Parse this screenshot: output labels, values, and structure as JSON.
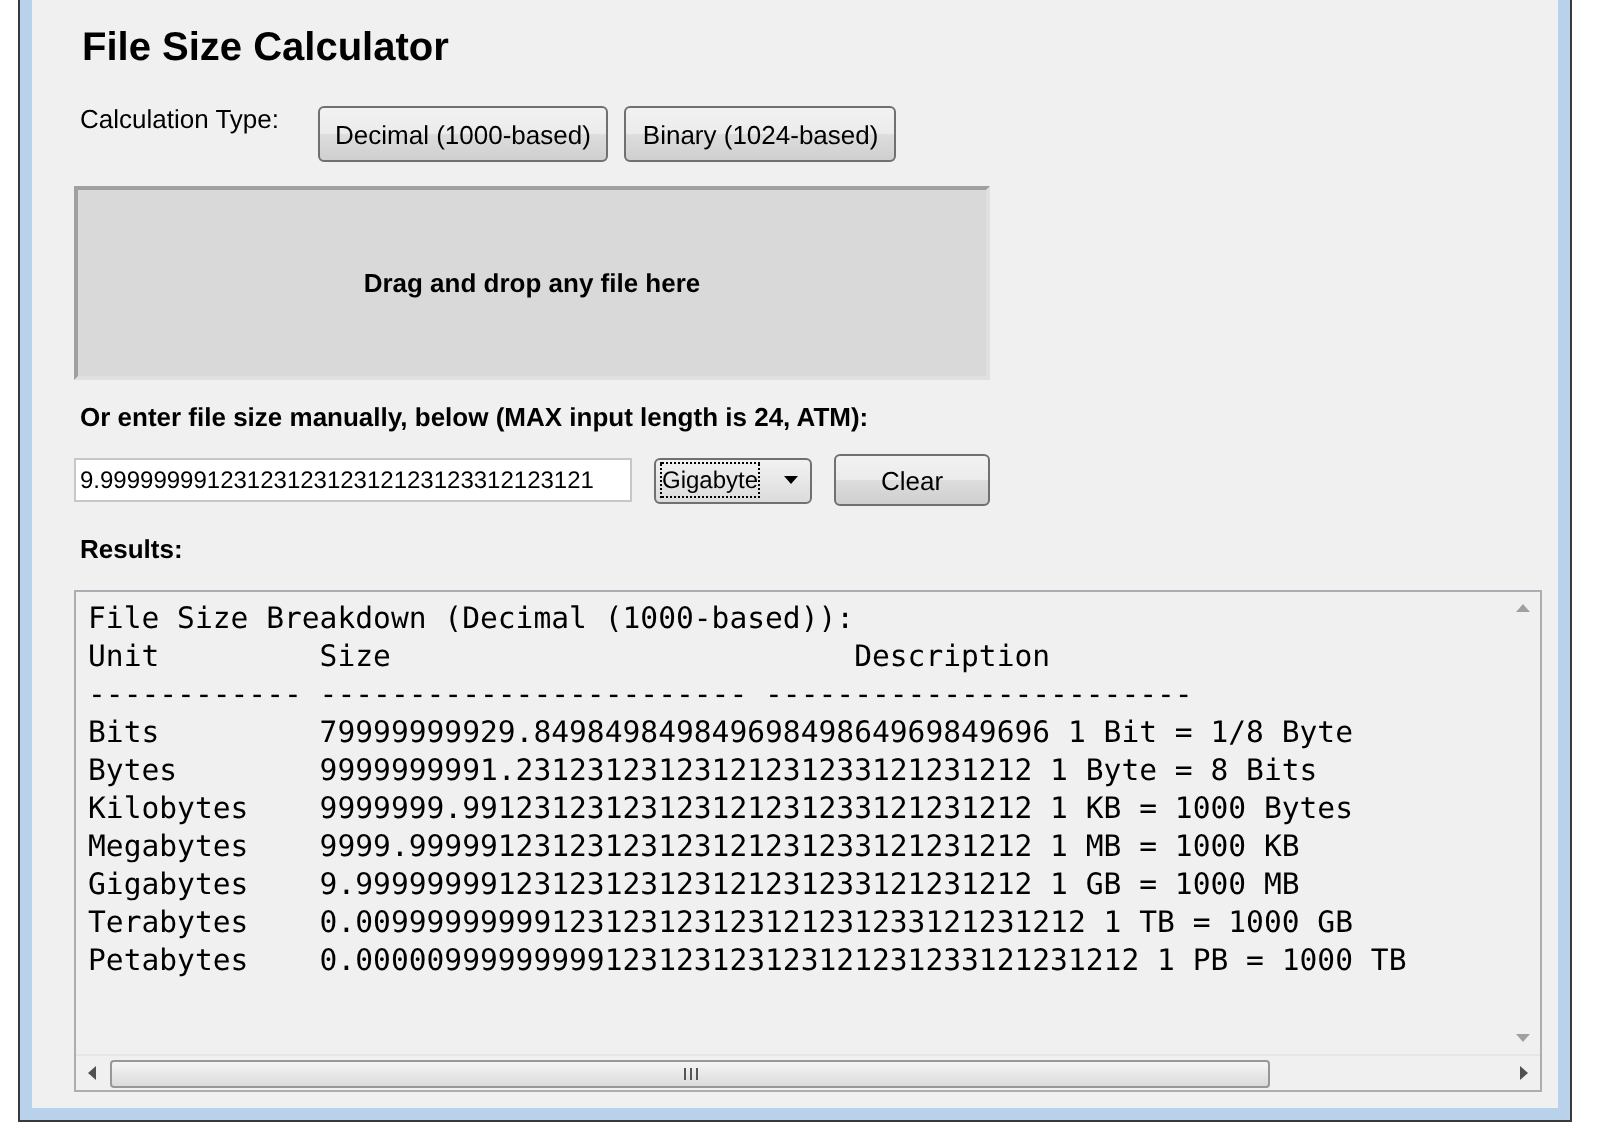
{
  "title": "File Size Calculator",
  "calculation_type": {
    "label": "Calculation Type:",
    "buttons": [
      "Decimal (1000-based)",
      "Binary (1024-based)"
    ]
  },
  "drop_zone": {
    "text": "Drag and drop any file here"
  },
  "manual_label": "Or enter file size manually, below (MAX input length is 24, ATM):",
  "size_field": {
    "value": "9.9999999912312312312312123123312123121"
  },
  "unit_dropdown": {
    "value": "Gigabyte"
  },
  "clear_button": "Clear",
  "results_label": "Results:",
  "results": {
    "lines": [
      "File Size Breakdown (Decimal (1000-based)):",
      "Unit         Size                          Description",
      "------------ ------------------------ ------------------------",
      "Bits         79999999929.84984984984969849864969849696 1 Bit = 1/8 Byte",
      "Bytes        9999999991.23123123123121231233121231212 1 Byte = 8 Bits",
      "Kilobytes    9999999.99123123123123121231233121231212 1 KB = 1000 Bytes",
      "Megabytes    9999.99999123123123123121231233121231212 1 MB = 1000 KB",
      "Gigabytes    9.99999999123123123123121231233121231212 1 GB = 1000 MB",
      "Terabytes    0.00999999999123123123123121231233121231212 1 TB = 1000 GB",
      "Petabytes    0.00000999999999123123123123121231233121231212 1 PB = 1000 TB"
    ]
  }
}
